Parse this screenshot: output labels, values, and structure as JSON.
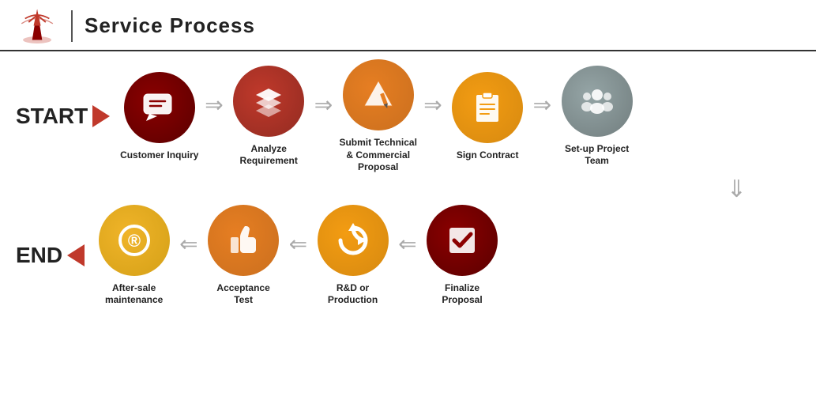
{
  "header": {
    "title": "Service Process"
  },
  "start_label": "START",
  "end_label": "END",
  "top_steps": [
    {
      "id": "customer-inquiry",
      "label": "Customer Inquiry",
      "color": "dark-red",
      "icon": "chat"
    },
    {
      "id": "analyze-requirement",
      "label": "Analyze Requirement",
      "color": "red",
      "icon": "layers"
    },
    {
      "id": "submit-proposal",
      "label": "Submit Technical\n& Commercial\nProposal",
      "color": "orange-red",
      "icon": "ruler"
    },
    {
      "id": "sign-contract",
      "label": "Sign Contract",
      "color": "orange",
      "icon": "clipboard"
    },
    {
      "id": "setup-team",
      "label": "Set-up Project Team",
      "color": "gray",
      "icon": "team"
    }
  ],
  "bottom_steps": [
    {
      "id": "aftersale",
      "label": "After-sale maintenance",
      "color": "gold",
      "icon": "registered"
    },
    {
      "id": "acceptance",
      "label": "Acceptance\nTest",
      "color": "orange-red2",
      "icon": "thumbsup"
    },
    {
      "id": "rd-production",
      "label": "R&D or\nProduction",
      "color": "orange2",
      "icon": "refresh"
    },
    {
      "id": "finalize",
      "label": "Finalize\nProposal",
      "color": "dark-red2",
      "icon": "checkbox"
    }
  ]
}
